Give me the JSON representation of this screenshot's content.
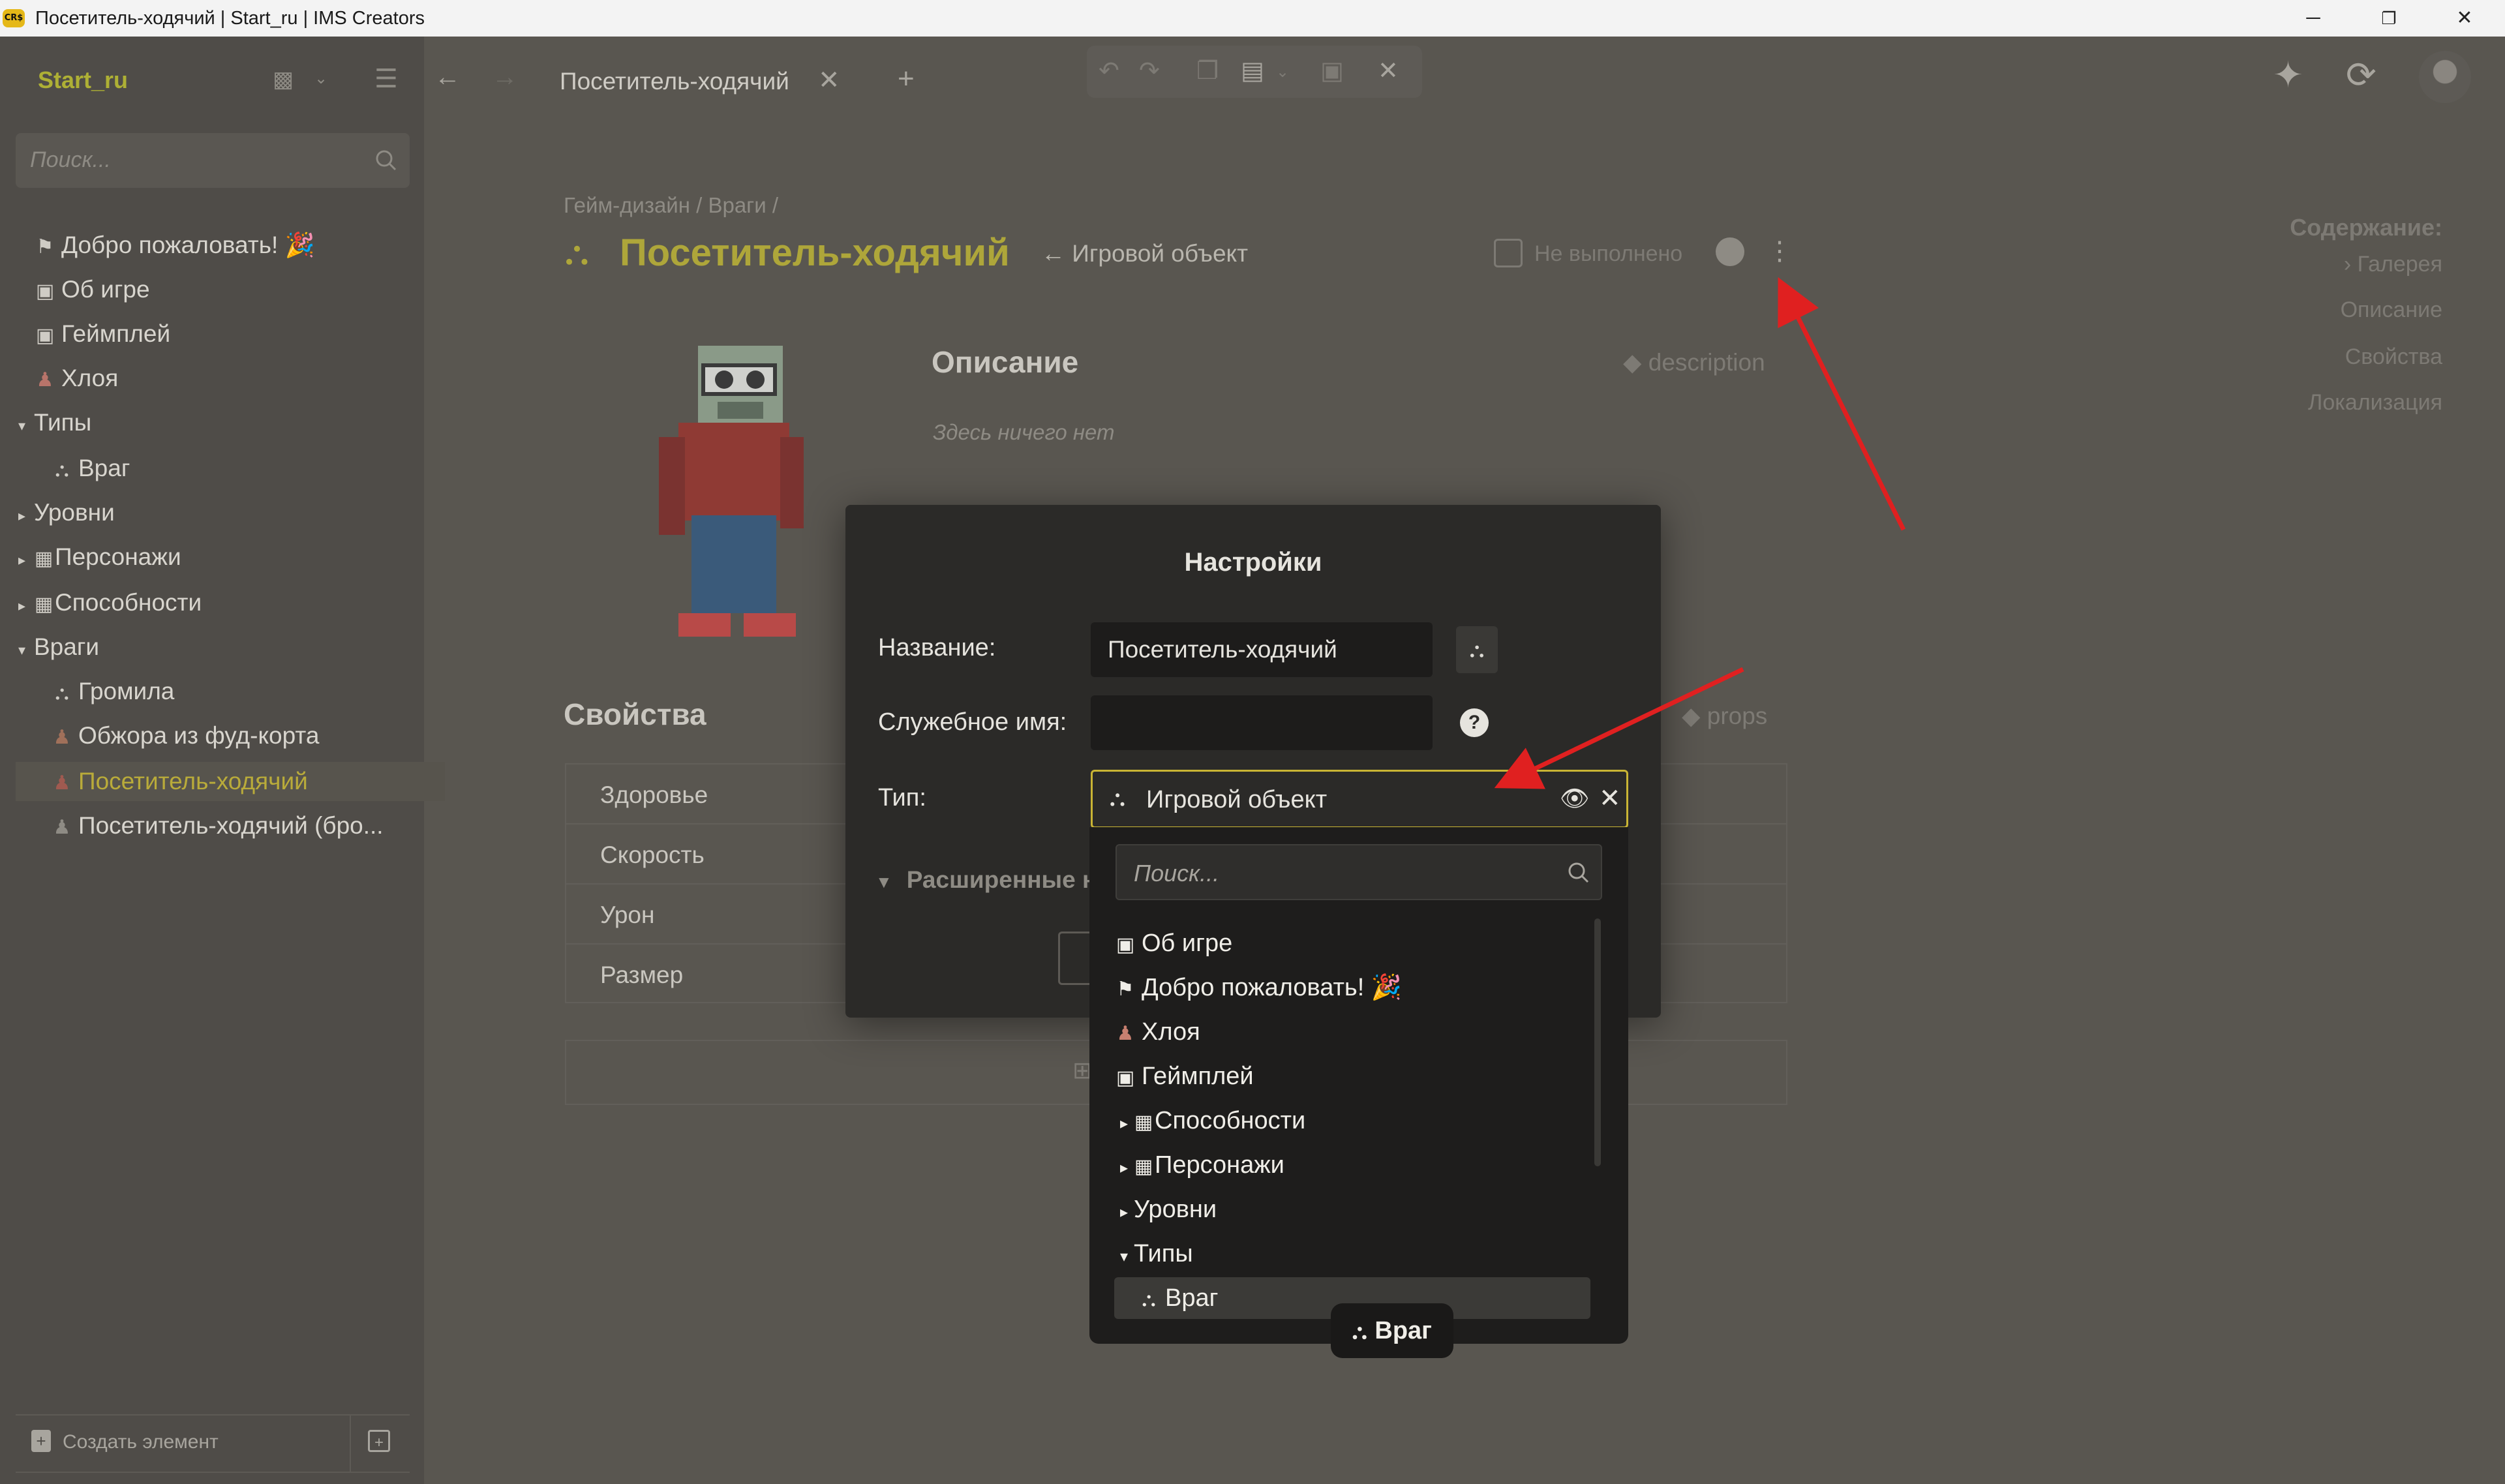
{
  "window": {
    "title": "Посетитель-ходячий | Start_ru | IMS Creators",
    "app_logo": "CR$",
    "controls": [
      "─",
      "❐",
      "✕"
    ]
  },
  "sidebar": {
    "project": "Start_ru",
    "search_placeholder": "Поиск...",
    "items": [
      {
        "label": "Добро пожаловать! 🎉",
        "icon": "flag-icon",
        "glyph": "⚑"
      },
      {
        "label": "Об игре",
        "icon": "markdown-icon",
        "glyph": "▣"
      },
      {
        "label": "Геймплей",
        "icon": "markdown-icon",
        "glyph": "▣"
      },
      {
        "label": "Хлоя",
        "icon": "character-icon",
        "glyph": "♟"
      },
      {
        "label": "Типы",
        "icon": "caret-down-icon",
        "glyph": "▾"
      },
      {
        "label": "Враг",
        "icon": "shapes-icon",
        "glyph": "⛬"
      },
      {
        "label": "Уровни",
        "icon": "caret-right-icon",
        "glyph": "▸"
      },
      {
        "label": "Персонажи",
        "icon": "table-icon",
        "glyph": "▦"
      },
      {
        "label": "Способности",
        "icon": "table-icon",
        "glyph": "▦"
      },
      {
        "label": "Враги",
        "icon": "caret-down-icon",
        "glyph": "▾"
      },
      {
        "label": "Громила",
        "icon": "shapes-icon",
        "glyph": "⛬"
      },
      {
        "label": "Обжора из фуд-корта",
        "icon": "enemy-icon",
        "glyph": "♟"
      },
      {
        "label": "Посетитель-ходячий",
        "icon": "enemy-icon",
        "glyph": "♟"
      },
      {
        "label": "Посетитель-ходячий (бро...",
        "icon": "enemy-icon",
        "glyph": "♟"
      }
    ],
    "create_label": "Создать элемент"
  },
  "header": {
    "tab_label": "Посетитель-ходячий",
    "tab_close": "✕",
    "new_tab": "+"
  },
  "page": {
    "breadcrumb": "Гейм-дизайн / Враги /",
    "title": "Посетитель-ходячий",
    "parent": "← Игровой объект",
    "status": "Не выполнено",
    "description_title": "Описание",
    "description_tag": "description",
    "description_empty": "Здесь ничего нет",
    "props_title": "Свойства",
    "props_tag": "props",
    "props": [
      "Здоровье",
      "Скорость",
      "Урон",
      "Размер"
    ]
  },
  "toc": {
    "title": "Содержание:",
    "items": [
      "› Галерея",
      "Описание",
      "Свойства",
      "Локализация"
    ]
  },
  "modal": {
    "title": "Настройки",
    "name_label": "Название:",
    "name_value": "Посетитель-ходячий",
    "service_label": "Служебное имя:",
    "service_value": "",
    "type_label": "Тип:",
    "type_value": "Игровой объект",
    "advanced": "Расширенные н",
    "help": "?"
  },
  "dropdown": {
    "search_placeholder": "Поиск...",
    "items": [
      {
        "label": "Об игре",
        "icon": "markdown-icon",
        "glyph": "▣",
        "tw": ""
      },
      {
        "label": "Добро пожаловать! 🎉",
        "icon": "flag-icon",
        "glyph": "⚑",
        "tw": ""
      },
      {
        "label": "Хлоя",
        "icon": "character-icon",
        "glyph": "♟",
        "tw": ""
      },
      {
        "label": "Геймплей",
        "icon": "markdown-icon",
        "glyph": "▣",
        "tw": ""
      },
      {
        "label": "Способности",
        "icon": "table-icon",
        "glyph": "▦",
        "tw": "▸"
      },
      {
        "label": "Персонажи",
        "icon": "table-icon",
        "glyph": "▦",
        "tw": "▸"
      },
      {
        "label": "Уровни",
        "icon": "",
        "glyph": "",
        "tw": "▸"
      },
      {
        "label": "Типы",
        "icon": "",
        "glyph": "",
        "tw": "▾"
      },
      {
        "label": "Враг",
        "icon": "shapes-icon",
        "glyph": "⛬",
        "tw": ""
      }
    ],
    "drag_chip": "Враг"
  },
  "colors": {
    "accent": "#aea63a",
    "select_border": "#c9b434",
    "annotation_arrow": "#e02020"
  }
}
